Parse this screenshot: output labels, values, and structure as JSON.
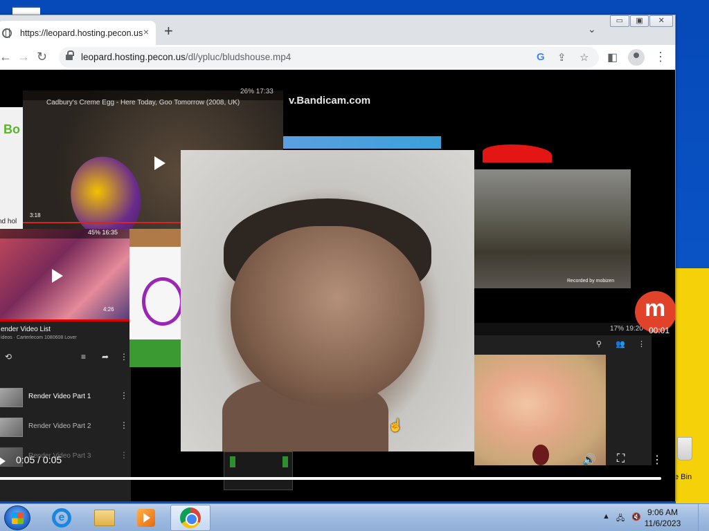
{
  "desktop": {
    "recycle_bin_label": "e Bin"
  },
  "browser": {
    "tab_title": "https://leopard.hosting.pecon.us",
    "tab_close": "×",
    "new_tab": "+",
    "tab_menu": "⌄",
    "window_buttons": {
      "minimize": "▭",
      "restore": "▣",
      "close": "✕"
    },
    "nav": {
      "back": "←",
      "forward": "→",
      "reload": "↻"
    },
    "url_host": "leopard.hosting.pecon.us",
    "url_path": "/dl/ypluc/bludshouse.mp4",
    "toolbar_icons": {
      "google": "G",
      "share": "⇪",
      "bookmark": "☆",
      "sidebar": "◧",
      "menu": "⋮"
    }
  },
  "video": {
    "time": "0:05 / 0:05",
    "progress": 1.0,
    "controls": {
      "volume": "🔊",
      "fullscreen": "⛶",
      "more": "⋮"
    },
    "overlay_texts": {
      "egg_title": "Cadbury's Creme Egg - Here Today, Goo Tomorrow (2008, UK)",
      "egg_time": "3:18",
      "status_a": "26% 17:33",
      "bandicam": "v.Bandicam.com",
      "left_brand": "Bo",
      "left_caption": "nd hol",
      "kids_status": "45% 16:35",
      "kids_duration": "4:26",
      "playlist_header": "ender Video List",
      "playlist_sub": "ideos · Carterlecom 1080608 Lover",
      "playlist_items": [
        {
          "label": "Render Video Part 1"
        },
        {
          "label": "Render Video Part 2"
        },
        {
          "label": "Render Video Part 3"
        }
      ],
      "recorded_by": "Recorded by mobizen",
      "girl_status": "17% 19:20",
      "m_letter": "m",
      "m_time": "00:01"
    }
  },
  "taskbar": {
    "clock_time": "9:06 AM",
    "clock_date": "11/6/2023",
    "tray": {
      "arrow": "▲",
      "network": "🖧",
      "volume_muted": "🔇"
    }
  }
}
